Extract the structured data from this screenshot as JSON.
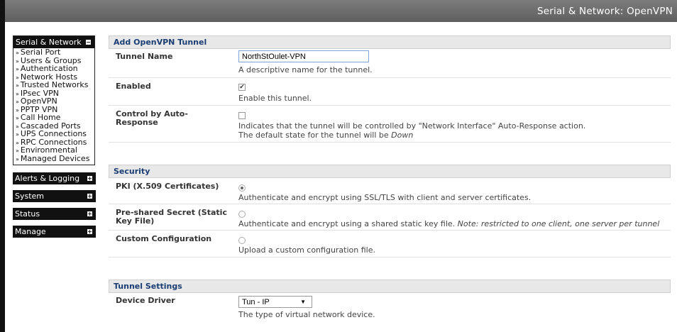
{
  "header": {
    "title": "Serial & Network: OpenVPN"
  },
  "sidebar": {
    "main_group": {
      "title": "Serial & Network",
      "items": [
        "Serial Port",
        "Users & Groups",
        "Authentication",
        "Network Hosts",
        "Trusted Networks",
        "IPsec VPN",
        "OpenVPN",
        "PPTP VPN",
        "Call Home",
        "Cascaded Ports",
        "UPS Connections",
        "RPC Connections",
        "Environmental",
        "Managed Devices"
      ]
    },
    "groups": [
      "Alerts & Logging",
      "System",
      "Status",
      "Manage"
    ],
    "arrow": "»",
    "collapse_glyph": "−",
    "expand_glyph": "+"
  },
  "add_tunnel": {
    "title": "Add OpenVPN Tunnel",
    "tunnel_name": {
      "label": "Tunnel Name",
      "value": "NorthStOulet-VPN",
      "desc": "A descriptive name for the tunnel."
    },
    "enabled": {
      "label": "Enabled",
      "checked": true,
      "desc": "Enable this tunnel."
    },
    "auto_response": {
      "label": "Control by Auto-Response",
      "checked": false,
      "desc1": "Indicates that the tunnel will be controlled by \"Network Interface\" Auto-Response action.",
      "desc2_prefix": "The default state for the tunnel will be ",
      "desc2_italic": "Down"
    }
  },
  "security": {
    "title": "Security",
    "pki": {
      "label": "PKI (X.509 Certificates)",
      "selected": true,
      "desc": "Authenticate and encrypt using SSL/TLS with client and server certificates."
    },
    "psk": {
      "label": "Pre-shared Secret (Static Key File)",
      "selected": false,
      "desc": "Authenticate and encrypt using a shared static key file. ",
      "note": "Note: restricted to one client, one server per tunnel"
    },
    "custom": {
      "label": "Custom Configuration",
      "selected": false,
      "desc": "Upload a custom configuration file."
    }
  },
  "tunnel_settings": {
    "title": "Tunnel Settings",
    "device_driver": {
      "label": "Device Driver",
      "selected": "Tun - IP",
      "caret": "▼",
      "desc": "The type of virtual network device."
    }
  },
  "colors": {
    "header_bg": "#6e6e6e",
    "section_title": "#1a3d73",
    "sidebar_head": "#111111"
  },
  "checkmark": "✔"
}
